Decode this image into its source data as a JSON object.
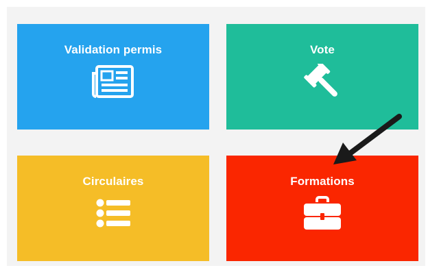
{
  "tiles": [
    {
      "label": "Validation permis",
      "icon": "newspaper-icon",
      "color": "#25a3ee"
    },
    {
      "label": "Vote",
      "icon": "gavel-icon",
      "color": "#1fbd9a"
    },
    {
      "label": "Circulaires",
      "icon": "list-icon",
      "color": "#f5bd27"
    },
    {
      "label": "Formations",
      "icon": "briefcase-icon",
      "color": "#fa2600"
    }
  ],
  "annotation": {
    "icon": "pointer-arrow-icon",
    "color": "#1a1a1a"
  }
}
